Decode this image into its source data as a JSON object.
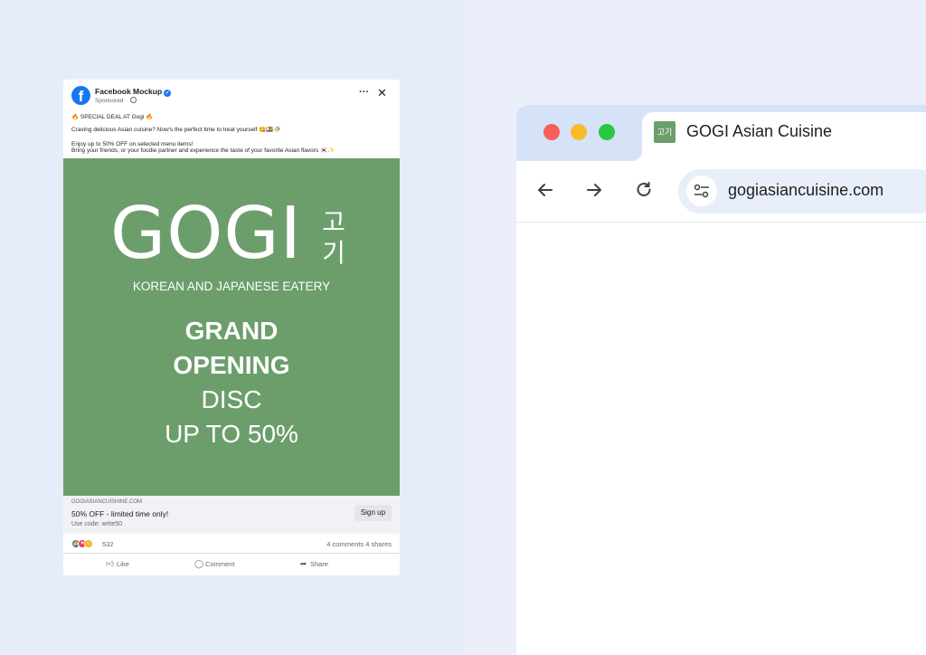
{
  "facebook_post": {
    "page_name": "Facebook Mockup",
    "sponsored": "Sponsored · ",
    "text_line1": "🔥 SPECIAL DEAL AT Gogi 🔥",
    "text_line2": "Craving delicious Asian cuisine? Now's the perfect time to treat yourself 😋🍱🍜",
    "text_line3": "Enjoy up to 50% OFF on selected menu items!",
    "text_line4": "Bring your friends, or your foodie partner and experience the taste of your favorite Asian flavors 🇰🇷✨",
    "ad": {
      "brand": "GOGI",
      "brand_hangul_1": "고",
      "brand_hangul_2": "기",
      "subtitle": "KOREAN AND JAPANESE EATERY",
      "line1": "GRAND",
      "line2": "OPENING",
      "line3": "DISC",
      "line4": "UP TO 50%",
      "background_color": "#6c9e6c"
    },
    "cta": {
      "domain": "GOGIASIANCUISHINE.COM",
      "headline": "50% OFF - limited time only!",
      "subtext": "Use code: write50",
      "button": "Sign up"
    },
    "reactions": {
      "count": "532",
      "stats": "4 comments 4 shares"
    },
    "actions": {
      "like": "Like",
      "comment": "Comment",
      "share": "Share"
    }
  },
  "browser": {
    "tab_title": "GOGI Asian Cuisine",
    "favicon_text": "고기",
    "url": "gogiasiancuisine.com",
    "icons": {
      "back": "arrow-left-icon",
      "forward": "arrow-right-icon",
      "reload": "reload-icon",
      "site_settings": "tune-icon"
    }
  },
  "colors": {
    "facebook_blue": "#1877f2",
    "ad_green": "#6c9e6c",
    "tabbar": "#d5e2f8",
    "background": "#e7edf8"
  }
}
